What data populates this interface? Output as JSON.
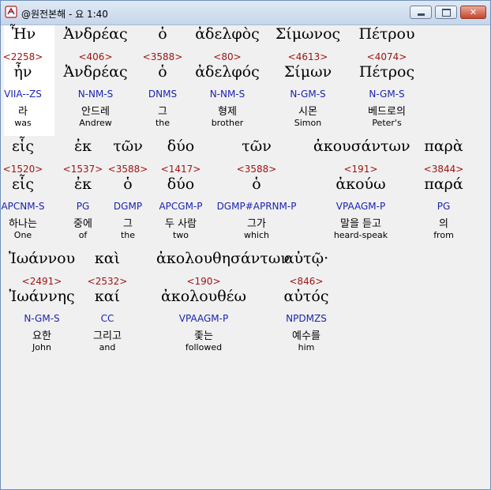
{
  "window": {
    "title": "@원전본해 - 요 1:40"
  },
  "icons": {
    "app": "app-icon",
    "minimize": "minimize-icon",
    "maximize": "maximize-icon",
    "close": "close-icon"
  },
  "rows": [
    {
      "words": [
        {
          "greek": "Ἦν",
          "strong": "<2258>",
          "lemma": "ἦν",
          "parsing": "VIIA--ZS",
          "korean": "라",
          "english": "was"
        },
        {
          "greek": "Ἀνδρέας",
          "strong": "<406>",
          "lemma": "Ἀνδρέας",
          "parsing": "N-NM-S",
          "korean": "안드레",
          "english": "Andrew"
        },
        {
          "greek": "ὁ",
          "strong": "<3588>",
          "lemma": "ὁ",
          "parsing": "DNMS",
          "korean": "그",
          "english": "the"
        },
        {
          "greek": "ἀδελφὸς",
          "strong": "<80>",
          "lemma": "ἀδελφός",
          "parsing": "N-NM-S",
          "korean": "형제",
          "english": "brother"
        },
        {
          "greek": "Σίμωνος",
          "strong": "<4613>",
          "lemma": "Σίμων",
          "parsing": "N-GM-S",
          "korean": "시몬",
          "english": "Simon"
        },
        {
          "greek": "Πέτρου",
          "strong": "<4074>",
          "lemma": "Πέτρος",
          "parsing": "N-GM-S",
          "korean": "베드로의",
          "english": "Peter's"
        }
      ]
    },
    {
      "words": [
        {
          "greek": "εἷς",
          "strong": "<1520>",
          "lemma": "εἷς",
          "parsing": "APCNM-S",
          "korean": "하나는",
          "english": "One"
        },
        {
          "greek": "ἐκ",
          "strong": "<1537>",
          "lemma": "ἐκ",
          "parsing": "PG",
          "korean": "중에",
          "english": "of"
        },
        {
          "greek": "τῶν",
          "strong": "<3588>",
          "lemma": "ὁ",
          "parsing": "DGMP",
          "korean": "그",
          "english": "the"
        },
        {
          "greek": "δύο",
          "strong": "<1417>",
          "lemma": "δύο",
          "parsing": "APCGM-P",
          "korean": "두 사람",
          "english": "two"
        },
        {
          "greek": "τῶν",
          "strong": "<3588>",
          "lemma": "ὁ",
          "parsing": "DGMP#APRNM-P",
          "korean": "그가",
          "english": "which"
        },
        {
          "greek": "ἀκουσάντων",
          "strong": "<191>",
          "lemma": "ἀκούω",
          "parsing": "VPAAGM-P",
          "korean": "말을 듣고",
          "english": "heard-speak"
        },
        {
          "greek": "παρὰ",
          "strong": "<3844>",
          "lemma": "παρά",
          "parsing": "PG",
          "korean": "의",
          "english": "from"
        }
      ]
    },
    {
      "words": [
        {
          "greek": "Ἰωάννου",
          "strong": "<2491>",
          "lemma": "Ἰωάννης",
          "parsing": "N-GM-S",
          "korean": "요한",
          "english": "John"
        },
        {
          "greek": "καὶ",
          "strong": "<2532>",
          "lemma": "καί",
          "parsing": "CC",
          "korean": "그리고",
          "english": "and"
        },
        {
          "greek": "ἀκολουθησάντων",
          "strong": "<190>",
          "lemma": "ἀκολουθέω",
          "parsing": "VPAAGM-P",
          "korean": "좇는",
          "english": "followed"
        },
        {
          "greek": "αὐτῷ·",
          "strong": "<846>",
          "lemma": "αὐτός",
          "parsing": "NPDMZS",
          "korean": "예수를",
          "english": "him"
        }
      ]
    }
  ]
}
